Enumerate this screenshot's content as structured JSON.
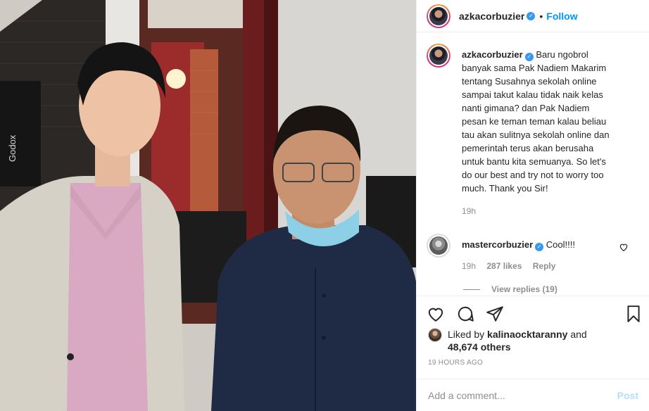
{
  "photo": {
    "brand_text": "Godox"
  },
  "header": {
    "username": "azkacorbuzier",
    "separator": "•",
    "follow_label": "Follow"
  },
  "caption": {
    "username": "azkacorbuzier",
    "text": "Baru ngobrol banyak sama Pak Nadiem Makarim tentang Susahnya sekolah online sampai takut kalau tidak naik kelas nanti gimana? dan Pak Nadiem pesan ke teman teman kalau beliau tau akan sulitnya sekolah online dan pemerintah terus akan berusaha untuk bantu kita semuanya. So let's do our best and try not to worry too much. Thank you Sir!",
    "age": "19h"
  },
  "comments": [
    {
      "username": "mastercorbuzier",
      "text": "Cool!!!!",
      "age": "19h",
      "likes": "287 likes",
      "reply_label": "Reply",
      "view_replies": "View replies (19)"
    }
  ],
  "likes": {
    "prefix": "Liked by ",
    "user": "kalinaocktaranny",
    "middle": " and",
    "count": "48,674 others"
  },
  "timestamp": "19 HOURS AGO",
  "add_comment": {
    "placeholder": "Add a comment...",
    "post_label": "Post"
  },
  "icons": {
    "verified": "verified-badge-icon",
    "like": "heart-icon",
    "comment": "comment-icon",
    "share": "paper-plane-icon",
    "save": "bookmark-icon"
  },
  "colors": {
    "accent": "#0095f6",
    "verified": "#3897f0",
    "muted": "#8e8e8e",
    "post_disabled": "#b2dffc"
  }
}
